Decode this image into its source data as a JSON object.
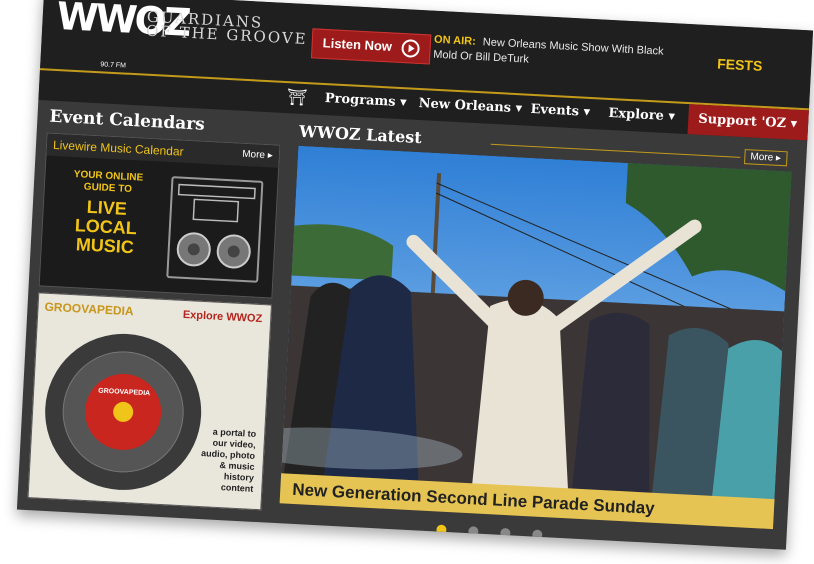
{
  "header": {
    "logo_text": "WWOZ",
    "logo_frequency": "90.7 FM",
    "tagline_1": "GUARDIANS",
    "tagline_2": "OF THE GROOVE",
    "listen_label": "Listen Now",
    "on_air_label": "ON AIR:",
    "on_air_text": "New Orleans Music Show With Black Mold Or Bill DeTurk",
    "fests_logo": "FESTS"
  },
  "nav": {
    "items": [
      "Programs",
      "New Orleans",
      "Events",
      "Explore"
    ],
    "support_label": "Support 'OZ"
  },
  "left": {
    "title": "Event Calendars",
    "livewire_title": "Livewire Music Calendar",
    "livewire_more": "More",
    "promo_sub": "YOUR ONLINE GUIDE TO",
    "promo_big": "LIVE LOCAL MUSIC",
    "groovapedia_title": "GROOVAPEDIA",
    "groovapedia_explore": "Explore WWOZ",
    "groovapedia_desc": "a portal to our video, audio, photo & music history content",
    "record_label": "GROOVAPEDIA"
  },
  "main": {
    "title": "WWOZ Latest",
    "more": "More",
    "caption": "New Generation Second Line Parade Sunday",
    "slides": 4,
    "active_slide": 1
  },
  "colors": {
    "accent_gold": "#f0c419",
    "accent_red": "#9e1b1b",
    "panel_dark": "#1f1f1f"
  }
}
